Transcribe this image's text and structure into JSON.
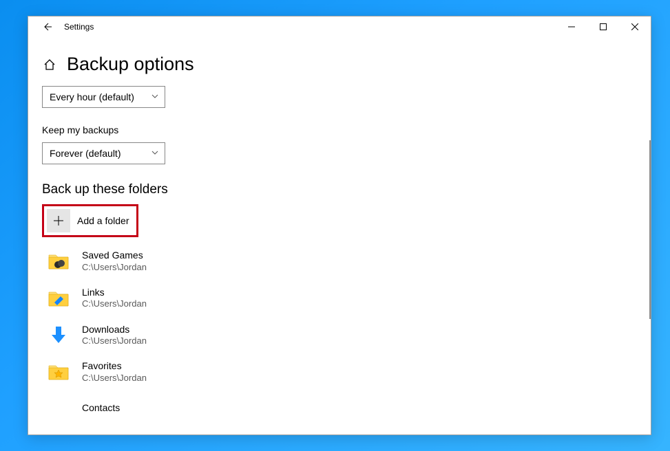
{
  "window": {
    "app_name": "Settings"
  },
  "page": {
    "title": "Backup options"
  },
  "backup_frequency": {
    "selected": "Every hour (default)"
  },
  "keep_backups": {
    "label": "Keep my backups",
    "selected": "Forever (default)"
  },
  "folders_section": {
    "heading": "Back up these folders",
    "add_label": "Add a folder",
    "items": [
      {
        "name": "Saved Games",
        "path": "C:\\Users\\Jordan",
        "icon": "saved-games"
      },
      {
        "name": "Links",
        "path": "C:\\Users\\Jordan",
        "icon": "links"
      },
      {
        "name": "Downloads",
        "path": "C:\\Users\\Jordan",
        "icon": "downloads"
      },
      {
        "name": "Favorites",
        "path": "C:\\Users\\Jordan",
        "icon": "favorites"
      },
      {
        "name": "Contacts",
        "path": "",
        "icon": "contacts"
      }
    ]
  }
}
